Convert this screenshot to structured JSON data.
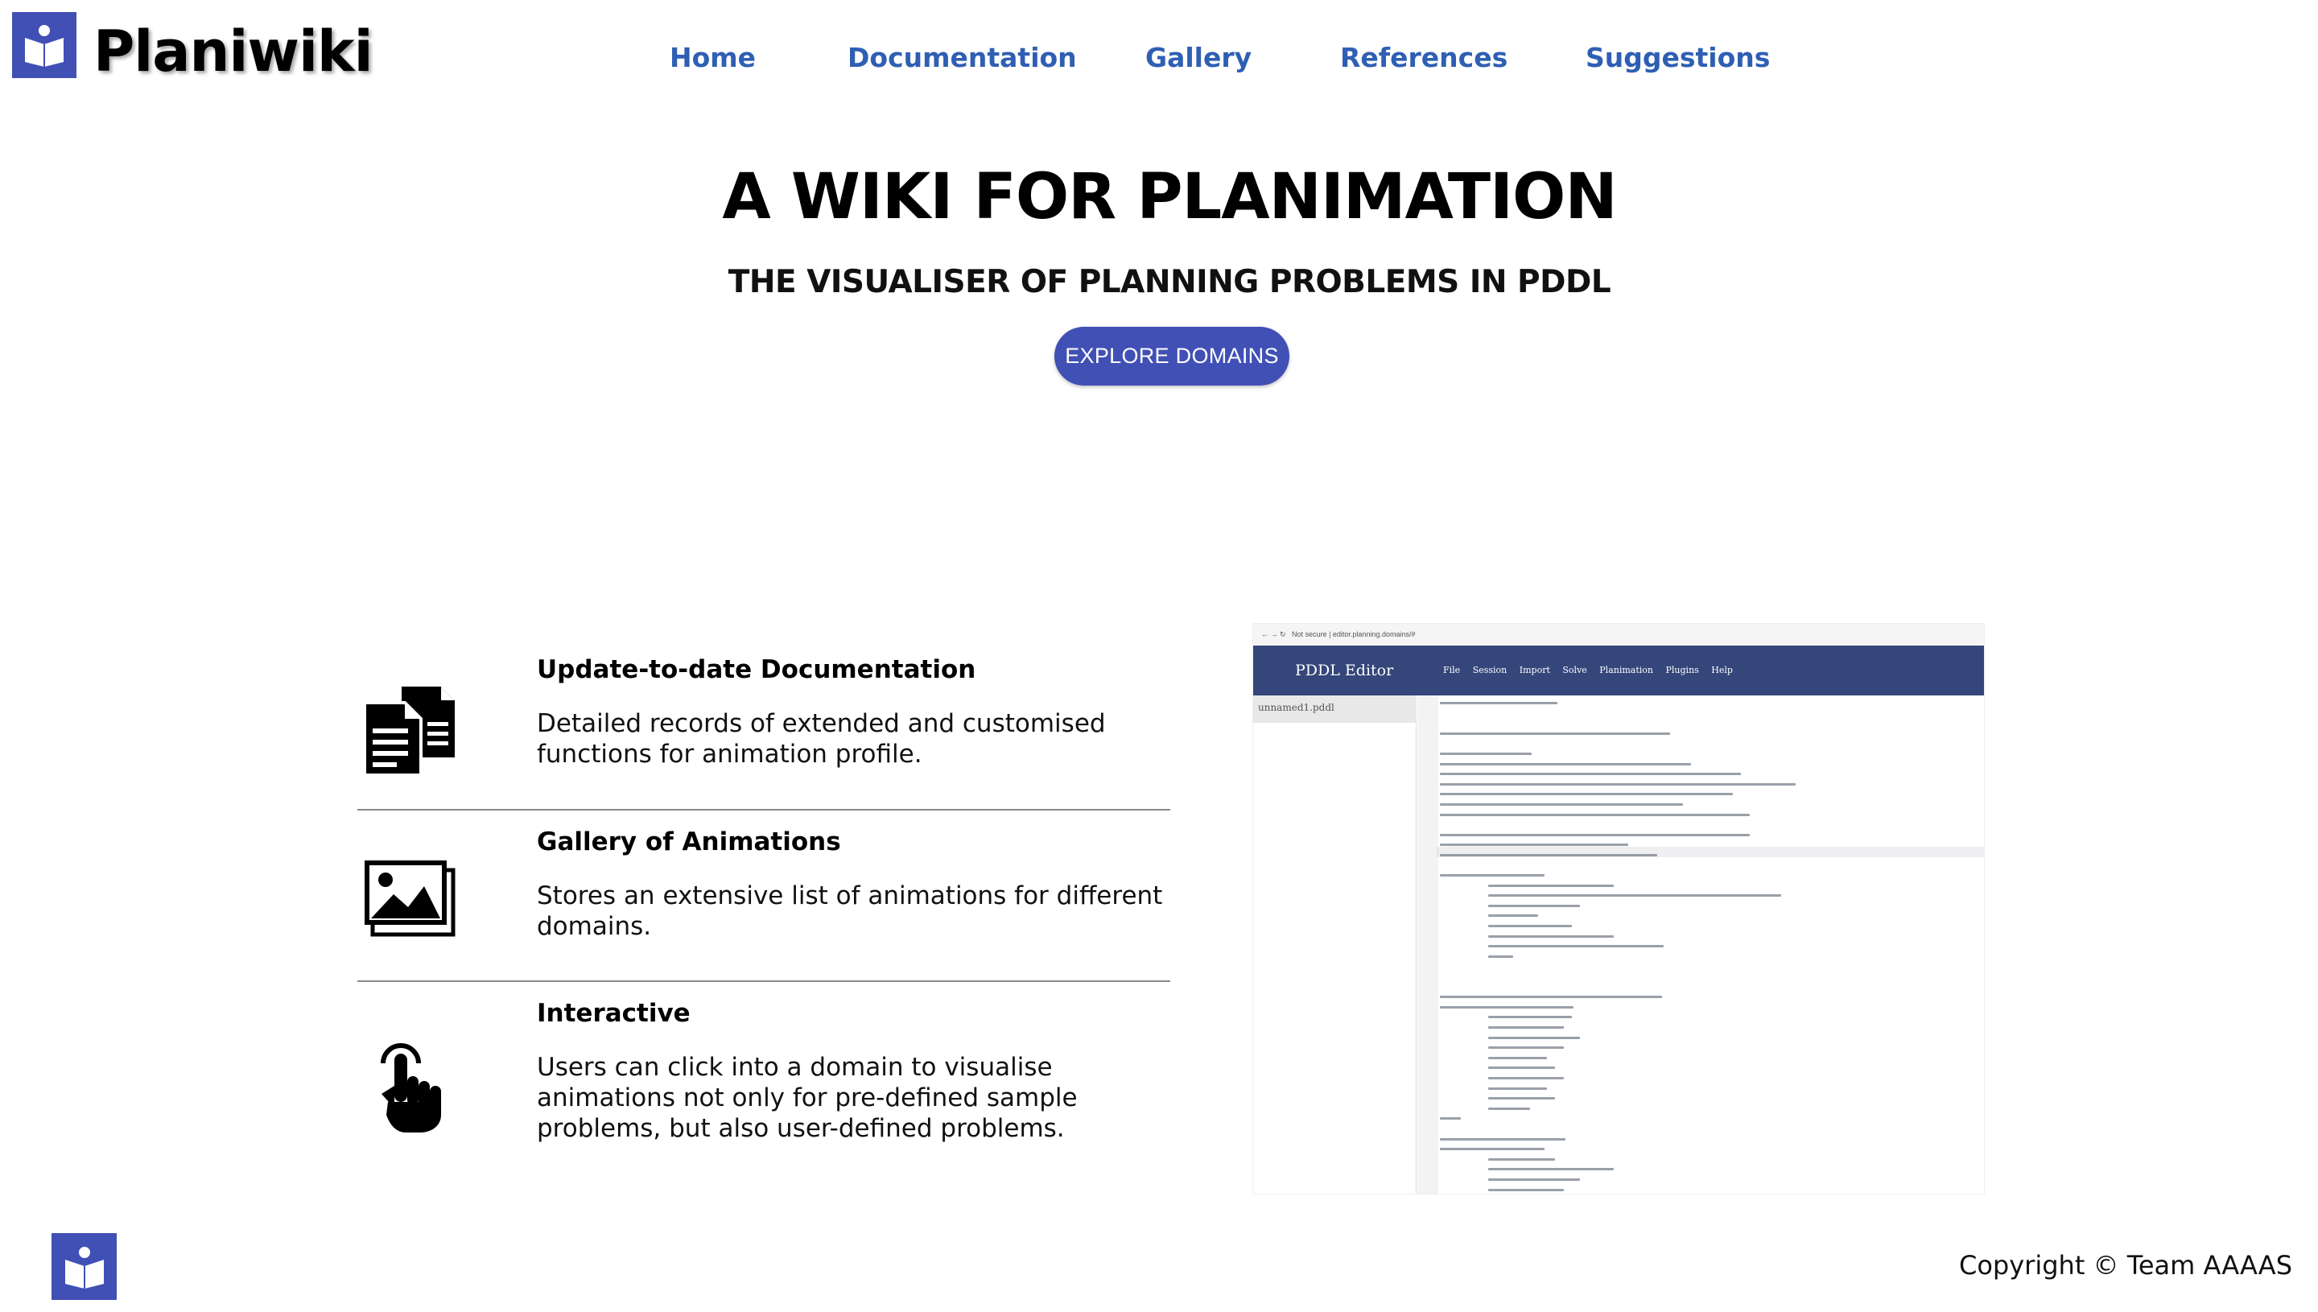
{
  "header": {
    "brand": "Planiwiki",
    "nav": [
      {
        "label": "Home"
      },
      {
        "label": "Documentation"
      },
      {
        "label": "Gallery"
      },
      {
        "label": "References"
      },
      {
        "label": "Suggestions"
      }
    ]
  },
  "hero": {
    "title": "A WIKI FOR PLANIMATION",
    "subtitle": "THE VISUALISER OF PLANNING PROBLEMS IN PDDL",
    "cta_label": "EXPLORE DOMAINS"
  },
  "features": [
    {
      "title": "Update-to-date Documentation",
      "text": "Detailed records of extended and customised functions for animation profile.",
      "icon": "documents-icon"
    },
    {
      "title": "Gallery of Animations",
      "text": "Stores an extensive list of animations for different domains.",
      "icon": "image-gallery-icon"
    },
    {
      "title": "Interactive",
      "text": "Users can click into a domain to visualise animations not only for pre-defined sample problems, but also user-defined problems.",
      "icon": "pointing-hand-icon"
    }
  ],
  "editor_screenshot": {
    "address": "Not secure | editor.planning.domains/#",
    "title": "PDDL Editor",
    "menu": [
      "File",
      "Session",
      "Import",
      "Solve",
      "Planimation",
      "Plugins",
      "Help"
    ],
    "file": "unnamed1.pddl"
  },
  "footer": {
    "copyright": "Copyright © Team AAAAS"
  },
  "colors": {
    "brand": "#4150b5",
    "nav_link": "#2f5fb3",
    "editor_bar": "#34467a"
  }
}
